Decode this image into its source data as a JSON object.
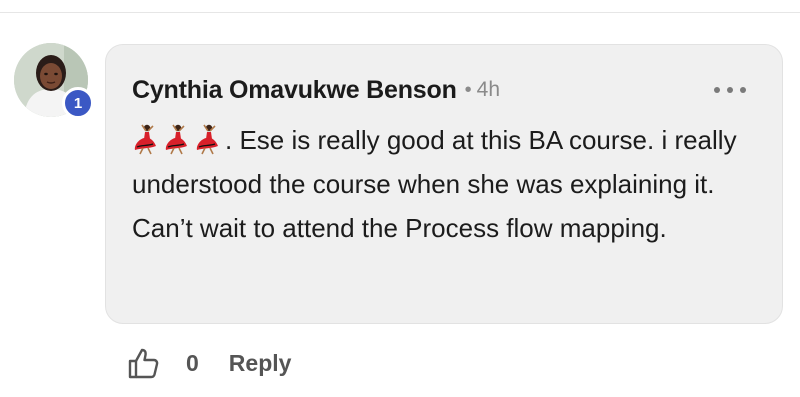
{
  "comment": {
    "author": "Cynthia Omavukwe Benson",
    "separator": "•",
    "time": "4h",
    "notification_count": "1",
    "emojis": [
      "dancer-emoji",
      "dancer-emoji",
      "dancer-emoji"
    ],
    "text": ". Ese is really good at this BA course. i really understood the course when she was explaining it. Can’t wait to attend the Process flow mapping."
  },
  "actions": {
    "like_icon": "thumbs-up-icon",
    "like_count": "0",
    "reply_label": "Reply",
    "more_icon": "more-horizontal-icon"
  },
  "colors": {
    "bubble_bg": "#f0f0f0",
    "badge": "#3b58c4",
    "muted_text": "#8a8a8a",
    "action_text": "#555555"
  }
}
